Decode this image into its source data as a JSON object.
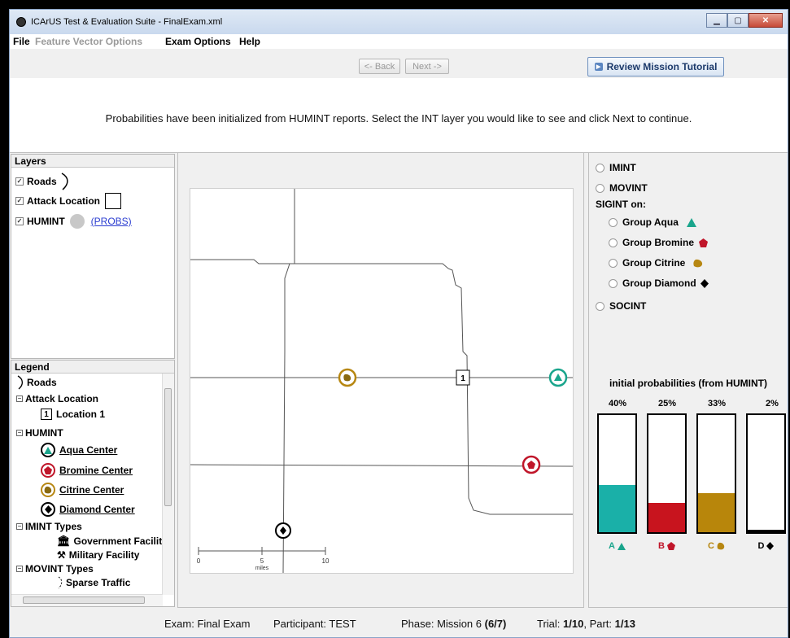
{
  "window": {
    "title": "ICArUS Test & Evaluation Suite - FinalExam.xml",
    "controls": [
      "minimize",
      "maximize",
      "close"
    ]
  },
  "menu": {
    "file": "File",
    "feature_vector_options": "Feature Vector Options",
    "exam_options": "Exam Options",
    "help": "Help"
  },
  "nav": {
    "back": "<- Back",
    "next": "Next ->",
    "tutorial": "Review Mission Tutorial"
  },
  "instructions": "Probabilities have been initialized from HUMINT reports. Select the INT layer you would like to see and click Next to continue.",
  "layers": {
    "title": "Layers",
    "items": [
      {
        "label": "Roads",
        "checked": true
      },
      {
        "label": "Attack Location",
        "checked": true
      },
      {
        "label": "HUMINT",
        "checked": true,
        "link": "(PROBS)"
      }
    ]
  },
  "legend": {
    "title": "Legend",
    "roads": "Roads",
    "attack_location": "Attack Location",
    "location_1": "Location 1",
    "location_1_num": "1",
    "humint": "HUMINT",
    "aqua": "Aqua Center",
    "bromine": "Bromine Center",
    "citrine": "Citrine Center",
    "diamond": "Diamond Center",
    "imint_types": "IMINT Types",
    "government": "Government Facilit",
    "military": "Military Facility",
    "movint_types": "MOVINT Types",
    "sparse_traffic": "Sparse Traffic"
  },
  "map": {
    "location_label": "1",
    "scale": {
      "ticks": [
        "0",
        "5",
        "10"
      ],
      "unit": "miles"
    }
  },
  "int_options": {
    "imint": "IMINT",
    "movint": "MOVINT",
    "sigint_on": "SIGINT on:",
    "groups": [
      {
        "label": "Group Aqua",
        "color": "#1aa58c"
      },
      {
        "label": "Group Bromine",
        "color": "#c0162a"
      },
      {
        "label": "Group Citrine",
        "color": "#b78712"
      },
      {
        "label": "Group Diamond",
        "color": "#000000"
      }
    ],
    "socint": "SOCINT"
  },
  "probabilities": {
    "title": "initial probabilities (from HUMINT)",
    "groups": [
      {
        "letter": "A",
        "percent_label": "40%",
        "value": 0.4,
        "color": "#1ab0a8"
      },
      {
        "letter": "B",
        "percent_label": "25%",
        "value": 0.25,
        "color": "#c8141e"
      },
      {
        "letter": "C",
        "percent_label": "33%",
        "value": 0.33,
        "color": "#b8860b"
      },
      {
        "letter": "D",
        "percent_label": "2%",
        "value": 0.02,
        "color": "#000000"
      }
    ]
  },
  "status": {
    "exam": "Exam: Final Exam",
    "participant": "Participant: TEST",
    "phase_prefix": "Phase: Mission 6 ",
    "phase_bold": "(6/7)",
    "trial_prefix": "Trial: ",
    "trial_bold": "1/10",
    "part_prefix": ", Part: ",
    "part_bold": "1/13"
  }
}
